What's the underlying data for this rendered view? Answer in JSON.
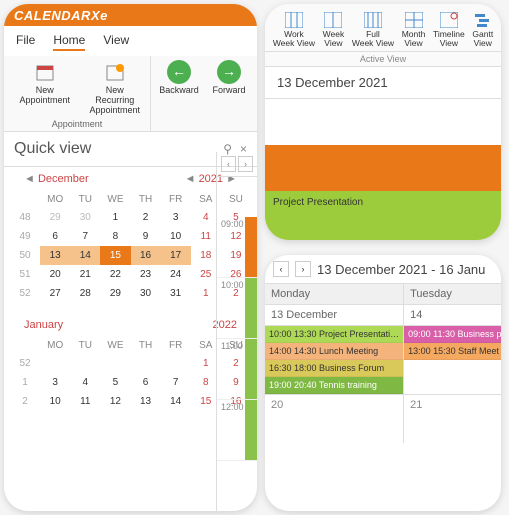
{
  "app": {
    "logo_a": "CALENDAR",
    "logo_b": "Xe"
  },
  "menu": {
    "file": "File",
    "home": "Home",
    "view": "View"
  },
  "ribbon": {
    "new_appt": "New Appointment",
    "new_rec": "New Recurring\nAppointment",
    "backward": "Backward",
    "forward": "Forward",
    "group_appt": "Appointment"
  },
  "qv": {
    "title": "Quick view",
    "pin": "⚲",
    "close": "×"
  },
  "cal1": {
    "month": "December",
    "year": "2021",
    "dow": [
      "MO",
      "TU",
      "WE",
      "TH",
      "FR",
      "SA",
      "SU"
    ],
    "rows": [
      {
        "wk": "48",
        "d": [
          "29",
          "30",
          "1",
          "2",
          "3",
          "4",
          "5"
        ]
      },
      {
        "wk": "49",
        "d": [
          "6",
          "7",
          "8",
          "9",
          "10",
          "11",
          "12"
        ]
      },
      {
        "wk": "50",
        "d": [
          "13",
          "14",
          "15",
          "16",
          "17",
          "18",
          "19"
        ]
      },
      {
        "wk": "51",
        "d": [
          "20",
          "21",
          "22",
          "23",
          "24",
          "25",
          "26"
        ]
      },
      {
        "wk": "52",
        "d": [
          "27",
          "28",
          "29",
          "30",
          "31",
          "1",
          "2"
        ]
      }
    ]
  },
  "cal2": {
    "month": "January",
    "year": "2022",
    "rows": [
      {
        "wk": "52",
        "d": [
          "",
          "",
          "",
          "",
          "",
          "1",
          "2"
        ]
      },
      {
        "wk": "1",
        "d": [
          "3",
          "4",
          "5",
          "6",
          "7",
          "8",
          "9"
        ]
      },
      {
        "wk": "2",
        "d": [
          "10",
          "11",
          "12",
          "13",
          "14",
          "15",
          "16"
        ]
      }
    ]
  },
  "hours": {
    "h9": "09:00",
    "h10": "10:00",
    "h11": "11:00",
    "h12": "12:00"
  },
  "views": {
    "work": "Work\nWeek View",
    "week": "Week\nView",
    "full": "Full\nWeek View",
    "month": "Month\nView",
    "timeline": "Timeline\nView",
    "gantt": "Gantt\nView",
    "group": "Active View"
  },
  "day": {
    "date": "13 December 2021",
    "proj": "Project Presentation"
  },
  "week": {
    "range": "13 December 2021 - 16 Janu",
    "col1": "Monday",
    "col2": "Tuesday",
    "d1": "13 December",
    "d2": "14",
    "d3": "20",
    "d4": "21",
    "e1": "10:00  13:30  Project Presentati…",
    "e2": "14:00  14:30  Lunch Meeting",
    "e3": "16:30  18:00  Business Forum",
    "e4": "19:00  20:40  Tennis training",
    "e5": "09:00  11:30  Business p",
    "e6": "13:00  15:30  Staff Meet"
  }
}
